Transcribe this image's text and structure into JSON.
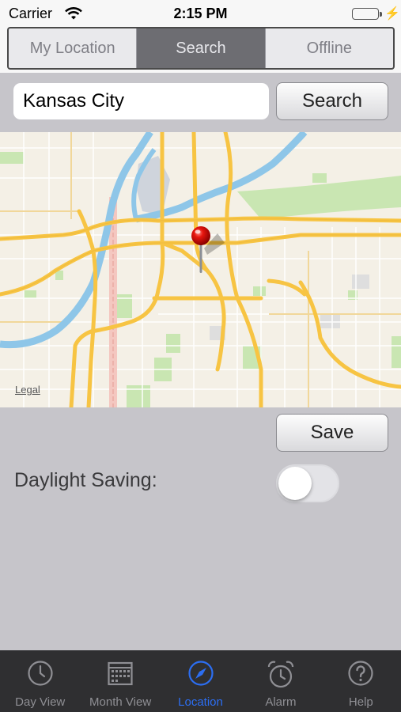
{
  "status_bar": {
    "carrier": "Carrier",
    "time": "2:15 PM"
  },
  "segments": [
    {
      "label": "My Location",
      "active": false
    },
    {
      "label": "Search",
      "active": true
    },
    {
      "label": "Offline",
      "active": false
    }
  ],
  "search": {
    "value": "Kansas City",
    "button_label": "Search"
  },
  "map": {
    "legal_label": "Legal",
    "pin_icon": "map-pin-icon"
  },
  "save_label": "Save",
  "daylight_saving": {
    "label": "Daylight Saving:",
    "enabled": false
  },
  "tabs": [
    {
      "label": "Day View",
      "icon": "clock-icon",
      "active": false
    },
    {
      "label": "Month View",
      "icon": "calendar-icon",
      "active": false
    },
    {
      "label": "Location",
      "icon": "compass-icon",
      "active": true
    },
    {
      "label": "Alarm",
      "icon": "alarm-icon",
      "active": false
    },
    {
      "label": "Help",
      "icon": "help-icon",
      "active": false
    }
  ],
  "colors": {
    "accent": "#2c6ef2",
    "tabbar_bg": "#2f2f31",
    "toggle_off": "#e3e3e7",
    "segment_active": "#6d6d72"
  }
}
